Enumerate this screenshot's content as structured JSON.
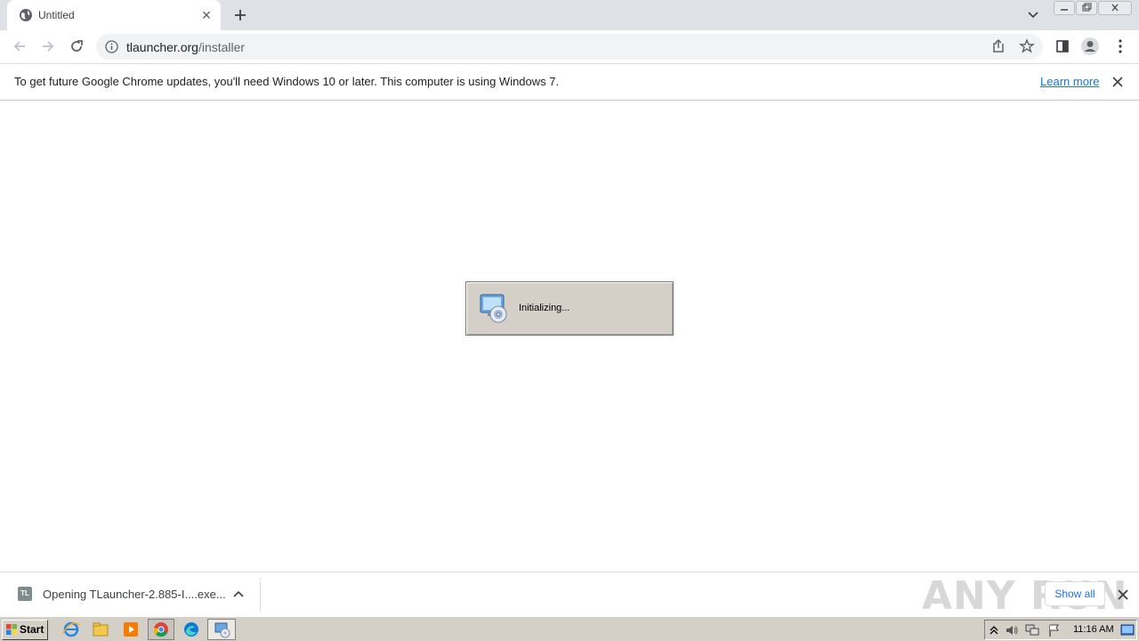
{
  "browser": {
    "tab": {
      "title": "Untitled",
      "favicon": "globe-icon"
    },
    "address": {
      "host": "tlauncher.org",
      "path": "/installer"
    },
    "infobar": {
      "message": "To get future Google Chrome updates, you'll need Windows 10 or later. This computer is using Windows 7.",
      "link": "Learn more"
    }
  },
  "dialog": {
    "text": "Initializing...",
    "icon": "installer-disc-icon"
  },
  "download_shelf": {
    "item_icon": "TL",
    "item_text": "Opening TLauncher-2.885-I....exe...",
    "show_all": "Show all",
    "watermark": "ANY RUN"
  },
  "taskbar": {
    "start_label": "Start",
    "clock": "11:16 AM"
  },
  "colors": {
    "accent": "#1a73e8",
    "tabstrip": "#dee1e6",
    "taskbar": "#d4d0c8"
  }
}
